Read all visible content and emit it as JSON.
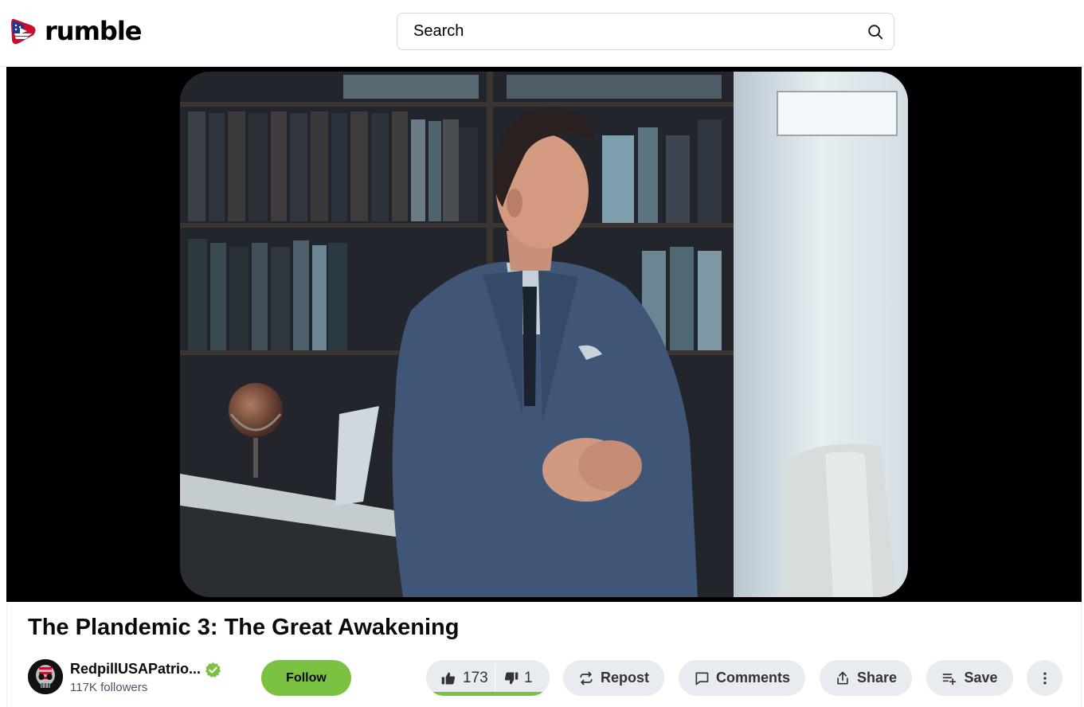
{
  "header": {
    "logo_text": "rumble",
    "search_placeholder": "Search"
  },
  "video": {
    "title": "The Plandemic 3: The Great Awakening"
  },
  "channel": {
    "name": "RedpillUSAPatrio...",
    "followers": "117K followers",
    "verified": true
  },
  "actions": {
    "follow_label": "Follow",
    "likes": "173",
    "dislikes": "1",
    "like_ratio": 0.99,
    "repost_label": "Repost",
    "comments_label": "Comments",
    "share_label": "Share",
    "save_label": "Save"
  },
  "icons": {
    "logo": "rumble-logo-icon",
    "search": "search-icon",
    "verified": "verified-check-icon",
    "like": "thumbs-up-icon",
    "dislike": "thumbs-down-icon",
    "repost": "repost-icon",
    "comments": "comment-icon",
    "share": "share-icon",
    "save": "playlist-add-icon",
    "more": "more-vertical-icon"
  },
  "colors": {
    "accent_green": "#7cc242",
    "button_bg": "#e8ecf0",
    "player_bg": "#000000"
  }
}
